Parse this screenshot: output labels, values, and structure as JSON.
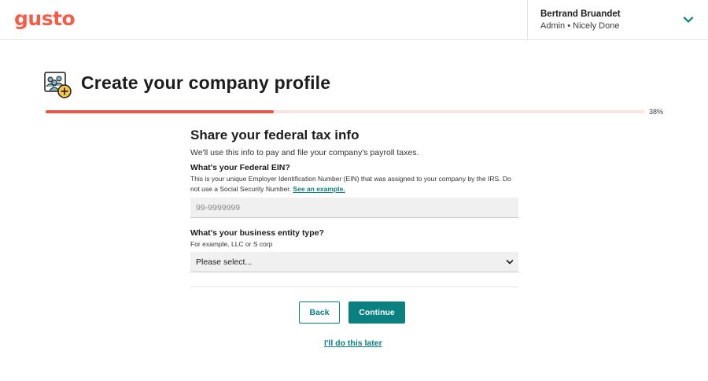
{
  "header": {
    "logo_text": "gusto",
    "user": {
      "name": "Bertrand Bruandet",
      "role": "Admin • Nicely Done"
    },
    "menu_icon": "chevron-down-icon"
  },
  "page": {
    "icon": "team-add-icon",
    "title": "Create your company profile"
  },
  "progress": {
    "value": 0.38,
    "label": "38%"
  },
  "section": {
    "title": "Share your federal tax info",
    "subtitle": "We'll use this info to pay and file your company's payroll taxes."
  },
  "ein": {
    "label": "What's your Federal EIN?",
    "help": "This is your unique Employer Identification Number (EIN) that was assigned to your company by the IRS. Do not use a Social Security Number.",
    "help_link": "See an example.",
    "placeholder": "99-9999999",
    "value": ""
  },
  "entity_type": {
    "label": "What's your business entity type?",
    "help": "For example, LLC or S corp",
    "selected": "Please select..."
  },
  "actions": {
    "back_label": "Back",
    "continue_label": "Continue",
    "later_label": "I'll do this later"
  },
  "colors": {
    "brand": "#f45d48",
    "progress": "#e05a46",
    "accent": "#0a8080"
  }
}
